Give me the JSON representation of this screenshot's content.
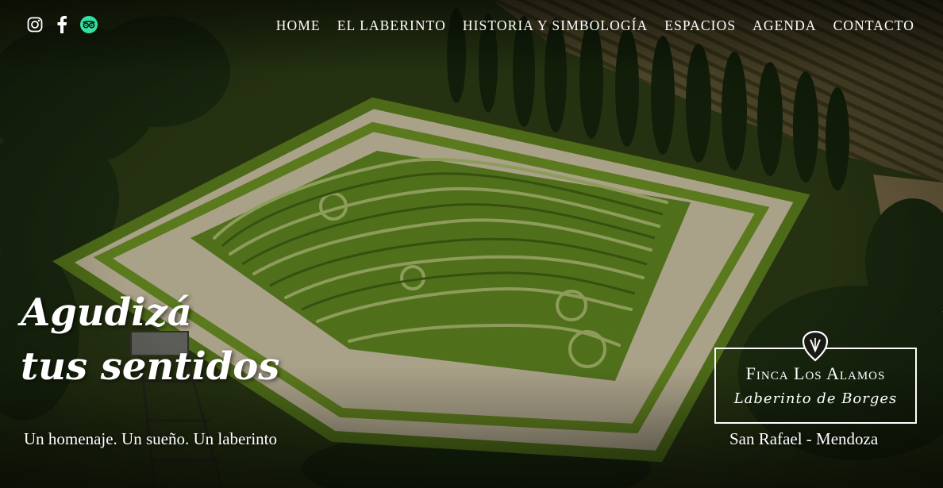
{
  "social": {
    "instagram_icon": "instagram-icon",
    "facebook_icon": "facebook-icon",
    "tripadvisor_icon": "tripadvisor-icon",
    "tripadvisor_color": "#34e0a1"
  },
  "nav": {
    "items": [
      {
        "label": "HOME"
      },
      {
        "label": "EL LABERINTO"
      },
      {
        "label": "HISTORIA Y SIMBOLOGÍA"
      },
      {
        "label": "ESPACIOS"
      },
      {
        "label": "AGENDA"
      },
      {
        "label": "CONTACTO"
      }
    ]
  },
  "hero": {
    "tagline_line1": "Agudizá",
    "tagline_line2": "tus sentidos",
    "subtitle": "Un homenaje. Un sueño. Un laberinto",
    "image": "aerial-hedge-maze-photo"
  },
  "logo": {
    "name": "Finca Los Alamos",
    "sub": "Laberinto de Borges"
  },
  "location": "San Rafael - Mendoza"
}
